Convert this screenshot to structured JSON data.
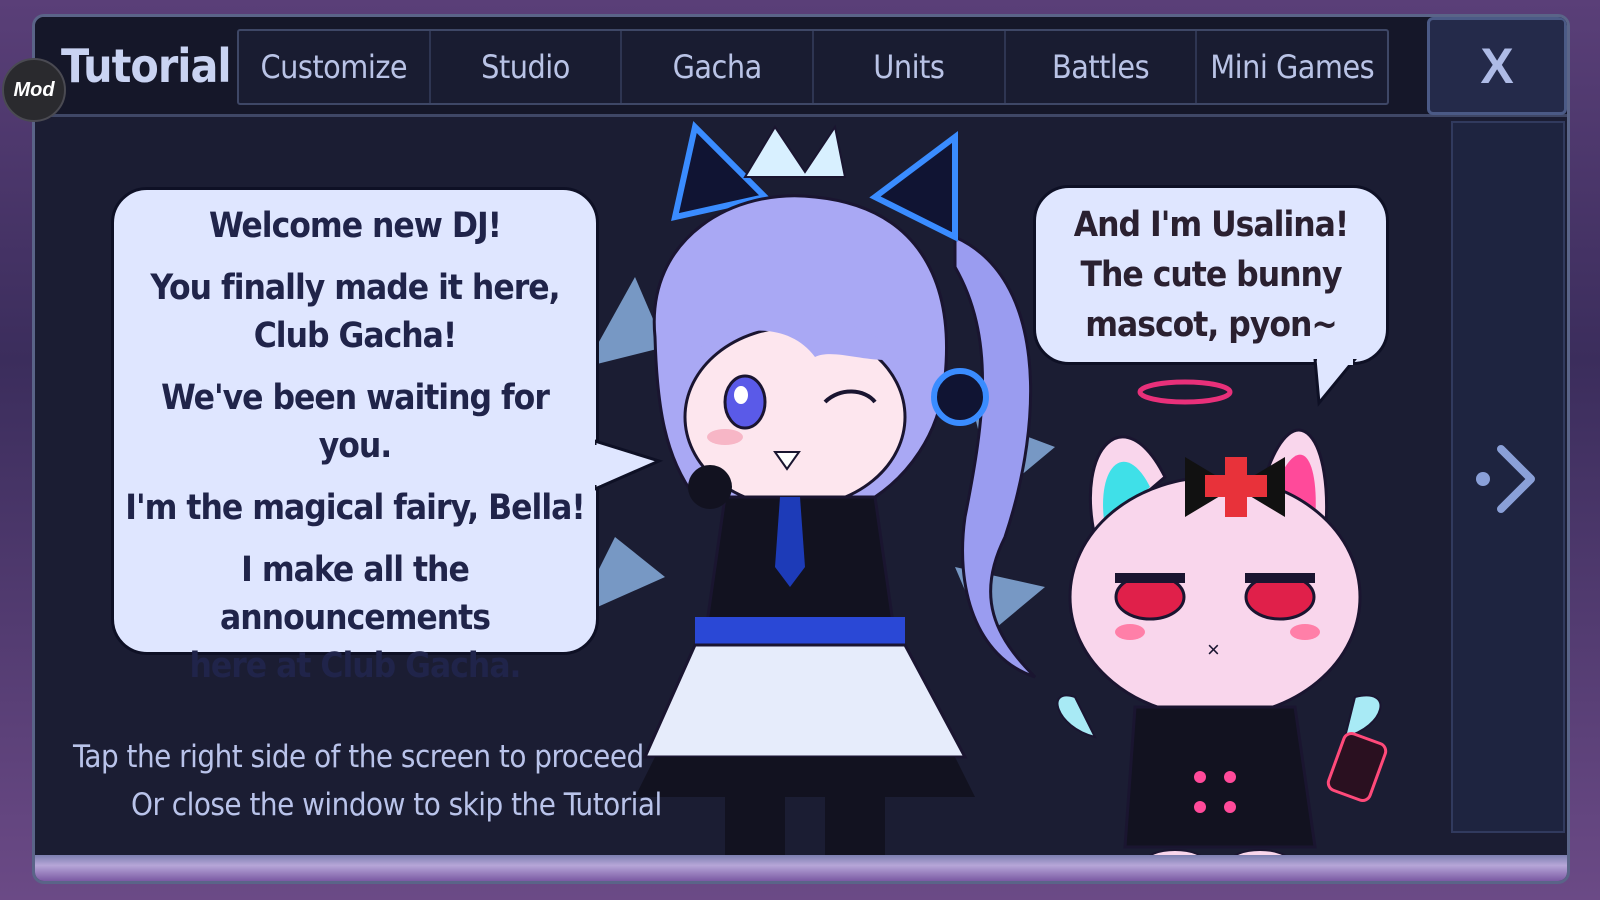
{
  "badge": {
    "label": "Mod"
  },
  "header": {
    "title": "Tutorial",
    "tabs": [
      {
        "label": "Customize"
      },
      {
        "label": "Studio"
      },
      {
        "label": "Gacha"
      },
      {
        "label": "Units"
      },
      {
        "label": "Battles"
      },
      {
        "label": "Mini Games"
      }
    ],
    "close_label": "X"
  },
  "dialogue": {
    "bella": {
      "line1": "Welcome new DJ!",
      "line2": "You finally made it here,",
      "line3": "Club Gacha!",
      "line4": "We've been waiting for you.",
      "line5": "I'm the magical fairy, Bella!",
      "line6": "I make all the announcements",
      "line7": "here at Club Gacha."
    },
    "usalina": {
      "line1": "And I'm Usalina!",
      "line2": "The cute bunny",
      "line3": "mascot, pyon~"
    }
  },
  "hints": {
    "proceed": "Tap the right side of the screen to proceed",
    "skip": "Or close the window to skip the Tutorial"
  },
  "icons": {
    "next": "chevron-right-icon",
    "close": "close-icon"
  },
  "colors": {
    "bubble": "#dfe6ff",
    "window": "#1b1d33",
    "accent": "#4a86ff"
  }
}
